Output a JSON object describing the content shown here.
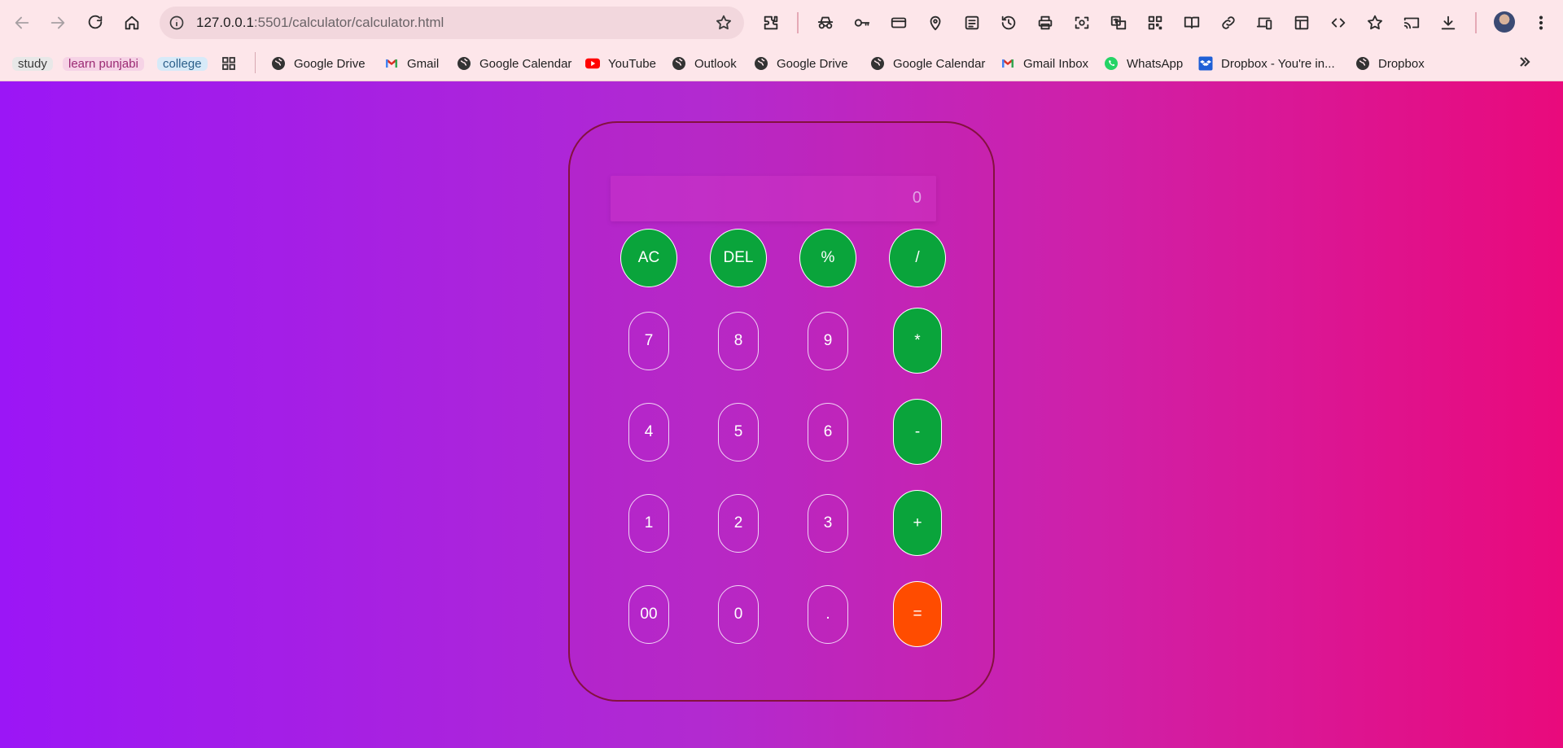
{
  "browser": {
    "url_host": "127.0.0.1",
    "url_rest": ":5501/calculator/calculator.html"
  },
  "bookmarks": [
    {
      "label": "study",
      "icon": "study-chip"
    },
    {
      "label": "learn punjabi",
      "icon": "punjabi-chip"
    },
    {
      "label": "college",
      "icon": "college-chip"
    },
    {
      "label": "",
      "icon": "apps-grid-icon"
    },
    {
      "label": "Google Drive",
      "icon": "globe-icon"
    },
    {
      "label": "Gmail",
      "icon": "gmail-icon"
    },
    {
      "label": "Google Calendar",
      "icon": "globe-icon"
    },
    {
      "label": "YouTube",
      "icon": "youtube-icon"
    },
    {
      "label": "Outlook",
      "icon": "globe-icon"
    },
    {
      "label": "Google Drive",
      "icon": "globe-icon"
    },
    {
      "label": "Google Calendar",
      "icon": "globe-icon"
    },
    {
      "label": "Gmail Inbox",
      "icon": "gmail-icon"
    },
    {
      "label": "WhatsApp",
      "icon": "whatsapp-icon"
    },
    {
      "label": "Dropbox - You're in...",
      "icon": "dropbox-icon"
    },
    {
      "label": "Dropbox",
      "icon": "globe-icon"
    }
  ],
  "calculator": {
    "display": "0",
    "keys": {
      "ac": "AC",
      "del": "DEL",
      "percent": "%",
      "divide": "/",
      "k7": "7",
      "k8": "8",
      "k9": "9",
      "multiply": "*",
      "k4": "4",
      "k5": "5",
      "k6": "6",
      "minus": "-",
      "k1": "1",
      "k2": "2",
      "k3": "3",
      "plus": "+",
      "k00": "00",
      "k0": "0",
      "dot": ".",
      "equals": "="
    }
  },
  "colors": {
    "function_key": "#0aa43b",
    "equals_key": "#ff4c00",
    "gradient_start": "#9b16f6",
    "gradient_end": "#e90a7c",
    "frame_border": "#84113f"
  }
}
